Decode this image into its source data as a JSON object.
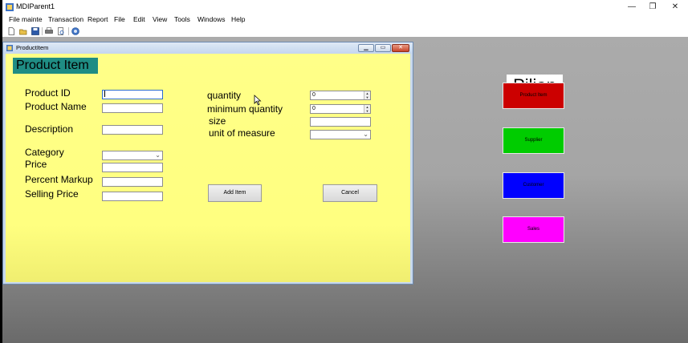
{
  "app": {
    "title": "MDIParent1"
  },
  "window_controls": {
    "minimize": "—",
    "maximize": "❐",
    "close": "✕"
  },
  "menu": [
    "File mainte",
    "Transaction",
    "Report",
    "File",
    "Edit",
    "View",
    "Tools",
    "Windows",
    "Help"
  ],
  "toolbar": {
    "icons": [
      "new-icon",
      "open-icon",
      "save-icon",
      "print-icon",
      "print-preview-icon",
      "help-icon"
    ]
  },
  "child": {
    "title": "ProductItem",
    "heading": "Product Item",
    "labels": {
      "product_id": "Product ID",
      "product_name": "Product Name",
      "description": "Description",
      "category": "Category",
      "price": "Price",
      "percent_markup": "Percent Markup",
      "selling_price": "Selling Price",
      "quantity": "quantity",
      "minimum_quantity": "minimum quantity",
      "size": "size",
      "unit_of_measure": "unit of measure"
    },
    "values": {
      "product_id": "",
      "product_name": "",
      "description": "",
      "category": "",
      "price": "",
      "percent_markup": "",
      "selling_price": "",
      "quantity": "0",
      "minimum_quantity": "0",
      "size": "",
      "unit_of_measure": ""
    },
    "buttons": {
      "add": "Add Item",
      "cancel": "Cancel"
    }
  },
  "side": {
    "title": "Pilian",
    "buttons": [
      {
        "label": "Product Item",
        "color": "#cc0000"
      },
      {
        "label": "Supplier",
        "color": "#00cc00"
      },
      {
        "label": "Customer",
        "color": "#0000ff"
      },
      {
        "label": "Sales",
        "color": "#ff00ff"
      }
    ]
  }
}
